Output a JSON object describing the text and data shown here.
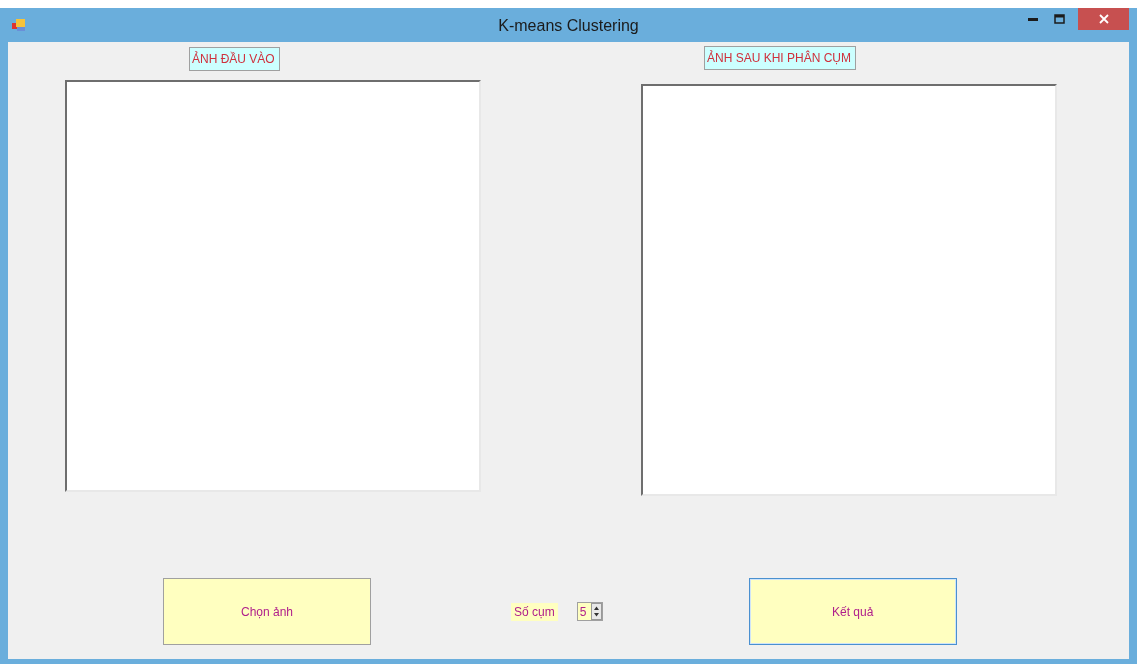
{
  "window": {
    "title": "K-means Clustering"
  },
  "panels": [
    {
      "label": "ẢNH ĐẦU VÀO"
    },
    {
      "label": "ẢNH SAU KHI PHÂN CỤM"
    }
  ],
  "cluster_count": {
    "label": "Số cụm",
    "value": "5"
  },
  "buttons": [
    {
      "label": "Chọn ảnh",
      "focused": false
    },
    {
      "label": "Kết quả",
      "focused": true
    }
  ]
}
